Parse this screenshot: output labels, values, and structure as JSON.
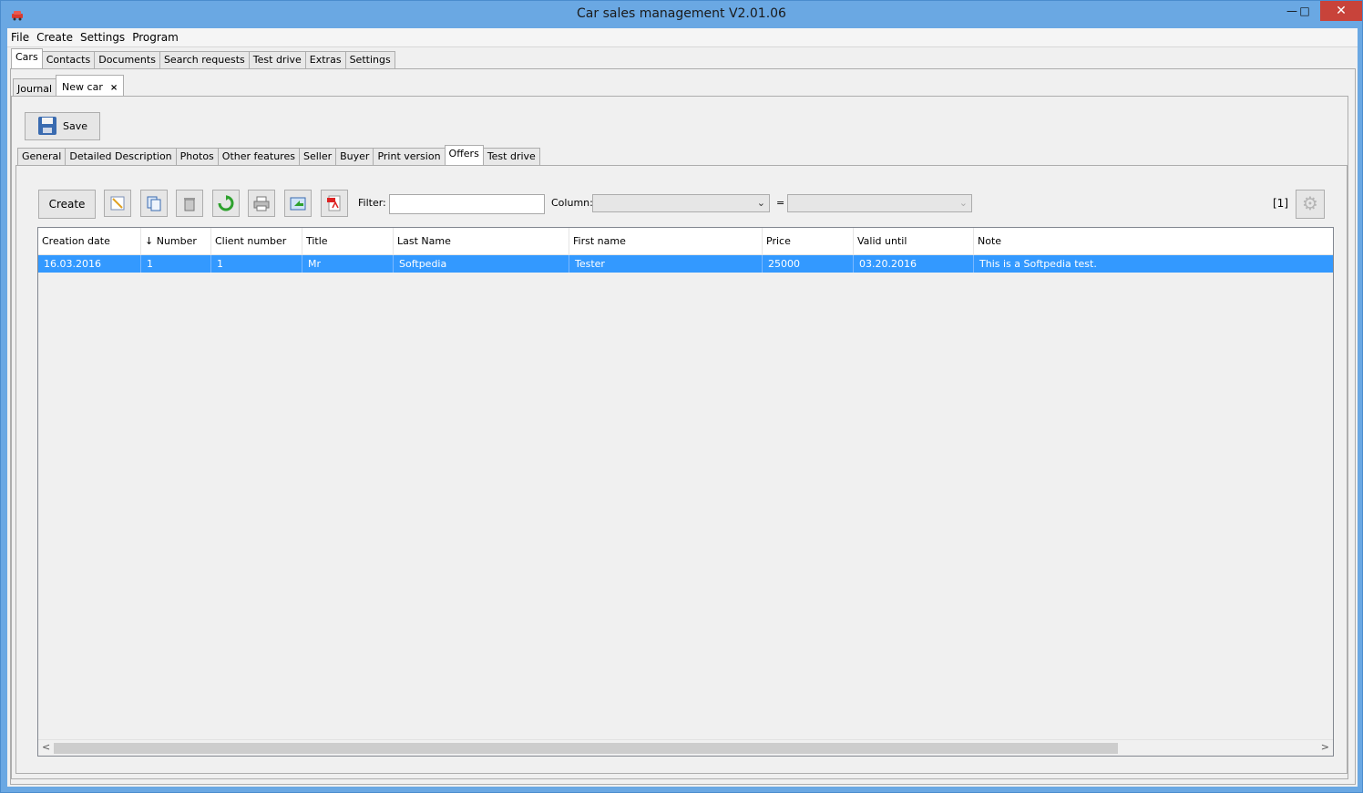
{
  "window": {
    "title": "Car sales management V2.01.06",
    "minimize": "—",
    "maximize": "□",
    "close": "✕"
  },
  "menu": [
    "File",
    "Create",
    "Settings",
    "Program"
  ],
  "main_tabs": [
    "Cars",
    "Contacts",
    "Documents",
    "Search requests",
    "Test drive",
    "Extras",
    "Settings"
  ],
  "sub_tabs": {
    "journal": "Journal",
    "new_car": "New car",
    "close": "×"
  },
  "save_label": "Save",
  "detail_tabs": [
    "General",
    "Detailed Description",
    "Photos",
    "Other features",
    "Seller",
    "Buyer",
    "Print version",
    "Offers",
    "Test drive"
  ],
  "toolbar": {
    "create_label": "Create",
    "filter_label": "Filter:",
    "filter_value": "",
    "column_label": "Column:",
    "equals": "=",
    "count": "[1]",
    "icons": [
      "edit-icon",
      "copy-icon",
      "trash-icon",
      "refresh-icon",
      "print-icon",
      "export-icon",
      "pdf-icon"
    ]
  },
  "table": {
    "columns": [
      "Creation date",
      "↓ Number",
      "Client number",
      "Title",
      "Last Name",
      "First name",
      "Price",
      "Valid until",
      "Note"
    ],
    "rows": [
      [
        "16.03.2016",
        "1",
        "1",
        "Mr",
        "Softpedia",
        "Tester",
        "25000",
        "03.20.2016",
        "This is a Softpedia test."
      ]
    ]
  },
  "scroll": {
    "left": "<",
    "right": ">"
  }
}
